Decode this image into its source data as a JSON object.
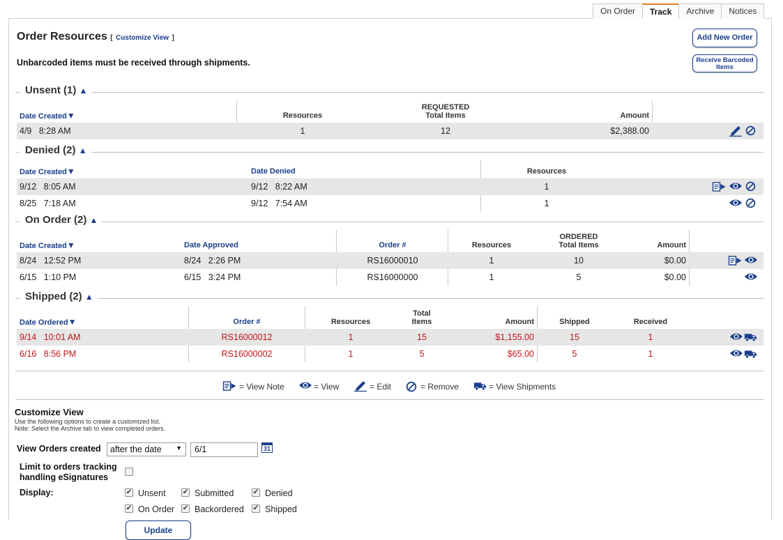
{
  "tabs": [
    {
      "label": "On Order",
      "active": false
    },
    {
      "label": "Track",
      "active": true
    },
    {
      "label": "Archive",
      "active": false
    },
    {
      "label": "Notices",
      "active": false
    }
  ],
  "header": {
    "title": "Order Resources",
    "customize_link": "Customize View",
    "bracket_open": "[",
    "bracket_close": "]",
    "notice": "Unbarcoded items must be received through shipments.",
    "add_order_label": "Add New Order",
    "receive_label_1": "Receive Barcoded",
    "receive_label_2": "Items"
  },
  "unsent": {
    "title": "Unsent (1)",
    "headers": {
      "date_created": "Date Created",
      "resources": "Resources",
      "requested": "REQUESTED",
      "total_items": "Total Items",
      "amount": "Amount"
    },
    "rows": [
      {
        "date": "4/9",
        "time": "8:28 AM",
        "resources": "1",
        "total_items": "12",
        "amount": "$2,388.00"
      }
    ]
  },
  "denied": {
    "title": "Denied (2)",
    "headers": {
      "date_created": "Date Created",
      "date_denied": "Date Denied",
      "resources": "Resources"
    },
    "rows": [
      {
        "date": "9/12",
        "time": "8:05 AM",
        "denied_date": "9/12",
        "denied_time": "8:22 AM",
        "resources": "1"
      },
      {
        "date": "8/25",
        "time": "7:18 AM",
        "denied_date": "9/12",
        "denied_time": "7:54 AM",
        "resources": "1"
      }
    ]
  },
  "on_order": {
    "title": "On Order (2)",
    "headers": {
      "date_created": "Date Created",
      "date_approved": "Date Approved",
      "order_no": "Order #",
      "resources": "Resources",
      "ordered": "ORDERED",
      "total_items": "Total Items",
      "amount": "Amount"
    },
    "rows": [
      {
        "date": "8/24",
        "time": "12:52 PM",
        "approved_date": "8/24",
        "approved_time": "2:26 PM",
        "order_no": "RS16000010",
        "resources": "1",
        "total_items": "10",
        "amount": "$0.00"
      },
      {
        "date": "6/15",
        "time": "1:10 PM",
        "approved_date": "6/15",
        "approved_time": "3:24 PM",
        "order_no": "RS16000000",
        "resources": "1",
        "total_items": "5",
        "amount": "$0.00"
      }
    ]
  },
  "shipped": {
    "title": "Shipped (2)",
    "headers": {
      "date_ordered": "Date Ordered",
      "order_no": "Order #",
      "resources": "Resources",
      "total": "Total",
      "items": "Items",
      "amount": "Amount",
      "shipped": "Shipped",
      "received": "Received"
    },
    "rows": [
      {
        "date": "9/14",
        "time": "10:01 AM",
        "order_no": "RS16000012",
        "resources": "1",
        "total_items": "15",
        "amount": "$1,155.00",
        "shipped": "15",
        "received": "1"
      },
      {
        "date": "6/16",
        "time": "8:56 PM",
        "order_no": "RS16000002",
        "resources": "1",
        "total_items": "5",
        "amount": "$65.00",
        "shipped": "5",
        "received": "1"
      }
    ]
  },
  "legend": {
    "view_note": "= View Note",
    "view": "= View",
    "edit": "= Edit",
    "remove": "= Remove",
    "view_shipments": "= View Shipments"
  },
  "customize": {
    "title": "Customize View",
    "help_1": "Use the following options to create a customized list.",
    "help_2": "Note: Select the Archive tab to view completed orders.",
    "view_orders_label": "View Orders created",
    "date_mode": "after the date",
    "date_value": "6/1",
    "calendar_label": "31",
    "limit_label_1": "Limit to orders tracking",
    "limit_label_2": "handling eSignatures",
    "limit_checked": false,
    "display_label": "Display:",
    "options": {
      "unsent": "Unsent",
      "submitted": "Submitted",
      "denied": "Denied",
      "on_order": "On Order",
      "backordered": "Backordered",
      "shipped": "Shipped"
    },
    "update_label": "Update"
  },
  "colors": {
    "accent": "#1b3f8b",
    "shipped_text": "#c0161b",
    "row_bg": "#e6e6e6",
    "active_tab": "#e07a1e"
  }
}
